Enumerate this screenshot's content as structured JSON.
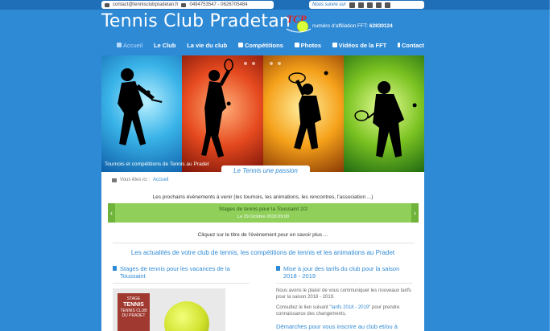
{
  "topbar": {
    "email": "contact@tennisclubpradetan.fr",
    "phones": "0494753547 - 0626705484",
    "follow_label": "Nous suivre sur",
    "social": [
      "facebook-icon",
      "twitter-icon",
      "youtube-icon",
      "google-plus-icon",
      "instagram-icon"
    ]
  },
  "header": {
    "title": "Tennis Club Pradetan",
    "logo_text": "TCP",
    "affiliation_label": "numéro d'affiliation FFT:",
    "affiliation_number": "62830124"
  },
  "nav": [
    {
      "label": "Accueil",
      "icon": "home-icon"
    },
    {
      "label": "Le Club",
      "icon": ""
    },
    {
      "label": "La vie du club",
      "icon": ""
    },
    {
      "label": "Compétitions",
      "icon": "trophy-icon"
    },
    {
      "label": "Photos",
      "icon": "camera-icon"
    },
    {
      "label": "Vidéos de la FFT",
      "icon": "video-icon"
    },
    {
      "label": "Contact",
      "icon": "info-icon"
    }
  ],
  "banner": {
    "caption": "Tournois et compétitions de Tennis au Pradet",
    "tagline": "Le Tennis une passion"
  },
  "breadcrumb": {
    "prefix": "Vous êtes ici :",
    "current": "Accueil"
  },
  "events": {
    "intro": "Les prochains évènements à venir (les tournois, les animations, les rencontres, l'association ...)",
    "title": "Stages de tennis pour la Toussaint 2/2",
    "date": "Le 29 Octobre 2018 09:00",
    "hint": "Cliquez sur le titre de l'évènement pour en savoir plus ..."
  },
  "news": {
    "heading": "Les actualités de votre club de tennis, les compétitions de tennis et les animations au Pradet",
    "left_title": "Stages de tennis pour les vacances de la Toussaint",
    "stage_img": {
      "line1": "STAGE",
      "line2": "TENNIS",
      "line3": "TENNIS CLUB",
      "line4": "DU PRADET"
    },
    "right_title": "Mise à jour des tarifs du club pour la saison 2018 - 2019",
    "right_text1": "Nous avons le plaisir de vous communiquer les nouveaux tarifs pour la saison 2018 - 2019.",
    "right_text2a": "Consultez le lien suivant \"",
    "right_link": "tarifs 2018 - 2019",
    "right_text2b": "\" pour prendre connaissance des changements.",
    "right_title2": "Démarches pour vous inscrire au club et/ou à l'école de tennis"
  }
}
